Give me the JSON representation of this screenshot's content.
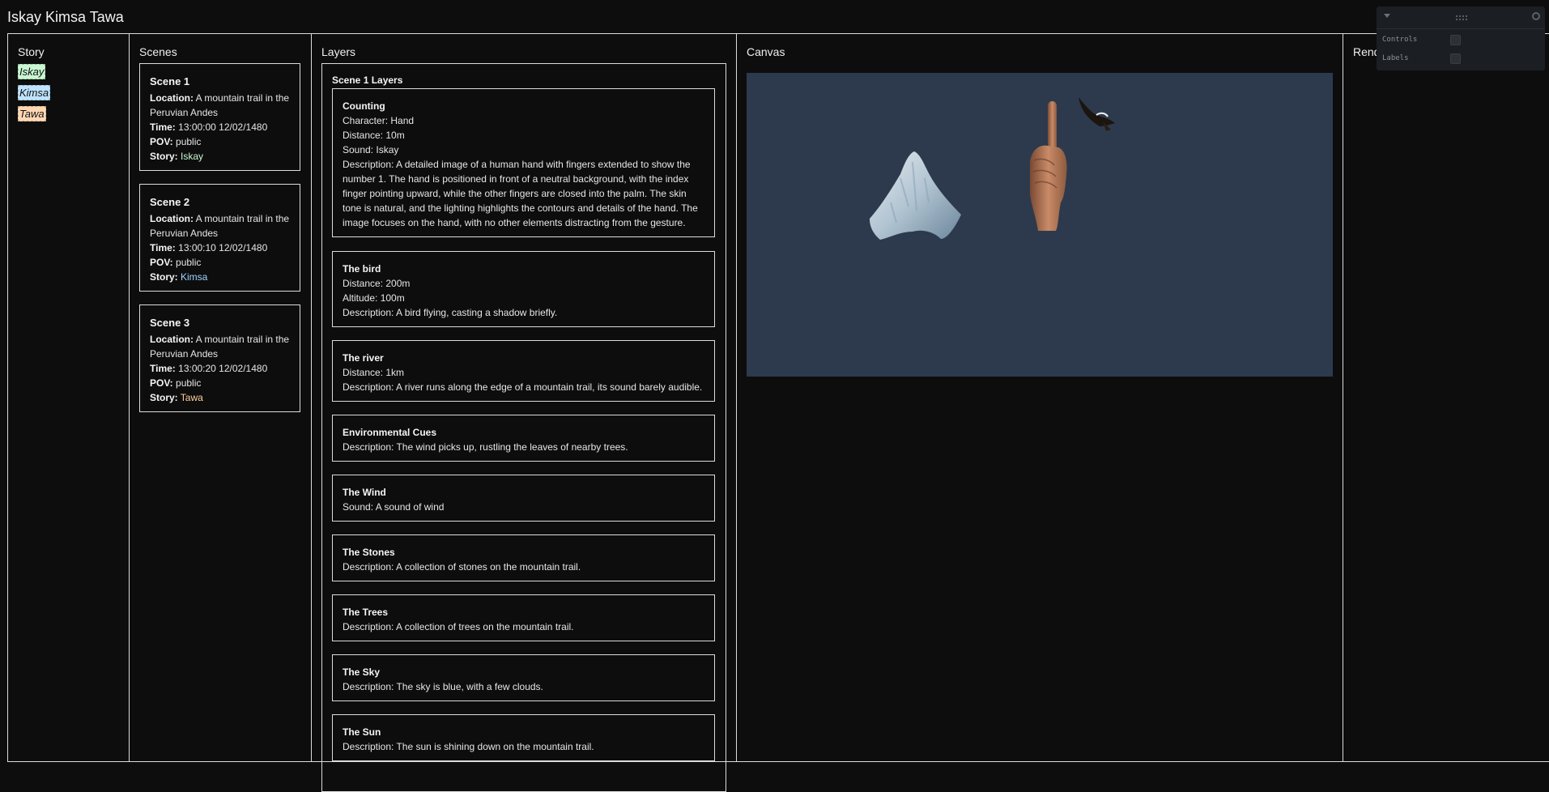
{
  "app": {
    "title": "Iskay Kimsa Tawa"
  },
  "columns": {
    "story": "Story",
    "scenes": "Scenes",
    "layers": "Layers",
    "canvas": "Canvas",
    "render": "Rend"
  },
  "story": {
    "items": [
      {
        "label": "Iskay",
        "color": "#c9f7d2"
      },
      {
        "label": "Kimsa",
        "color": "#bfe3ff"
      },
      {
        "label": "Tawa",
        "color": "#ffd8b3"
      }
    ]
  },
  "field_labels": {
    "location": "Location:",
    "time": "Time:",
    "pov": "POV:",
    "story": "Story:"
  },
  "scenes": [
    {
      "title": "Scene 1",
      "location": "A mountain trail in the Peruvian Andes",
      "time": "13:00:00 12/02/1480",
      "pov": "public",
      "story": "Iskay",
      "story_color": "#c9f7d2"
    },
    {
      "title": "Scene 2",
      "location": "A mountain trail in the Peruvian Andes",
      "time": "13:00:10 12/02/1480",
      "pov": "public",
      "story": "Kimsa",
      "story_color": "#9fd3ff"
    },
    {
      "title": "Scene 3",
      "location": "A mountain trail in the Peruvian Andes",
      "time": "13:00:20 12/02/1480",
      "pov": "public",
      "story": "Tawa",
      "story_color": "#ffd19a"
    }
  ],
  "layers": {
    "title": "Scene 1 Layers",
    "items": [
      {
        "title": "Counting",
        "lines": [
          "Character: Hand",
          "Distance: 10m",
          "Sound: Iskay",
          "Description: A detailed image of a human hand with fingers extended to show the number 1. The hand is positioned in front of a neutral background, with the index finger pointing upward, while the other fingers are closed into the palm. The skin tone is natural, and the lighting highlights the contours and details of the hand. The image focuses on the hand, with no other elements distracting from the gesture."
        ]
      },
      {
        "title": "The bird",
        "lines": [
          "Distance: 200m",
          "Altitude: 100m",
          "Description: A bird flying, casting a shadow briefly."
        ]
      },
      {
        "title": "The river",
        "lines": [
          "Distance: 1km",
          "Description: A river runs along the edge of a mountain trail, its sound barely audible."
        ]
      },
      {
        "title": "Environmental Cues",
        "lines": [
          "Description: The wind picks up, rustling the leaves of nearby trees."
        ]
      },
      {
        "title": "The Wind",
        "lines": [
          "Sound: A sound of wind"
        ]
      },
      {
        "title": "The Stones",
        "lines": [
          "Description: A collection of stones on the mountain trail."
        ]
      },
      {
        "title": "The Trees",
        "lines": [
          "Description: A collection of trees on the mountain trail."
        ]
      },
      {
        "title": "The Sky",
        "lines": [
          "Description: The sky is blue, with a few clouds."
        ]
      },
      {
        "title": "The Sun",
        "lines": [
          "Description: The sun is shining down on the mountain trail."
        ]
      }
    ]
  },
  "gui": {
    "controls_label": "Controls",
    "labels_label": "Labels"
  }
}
